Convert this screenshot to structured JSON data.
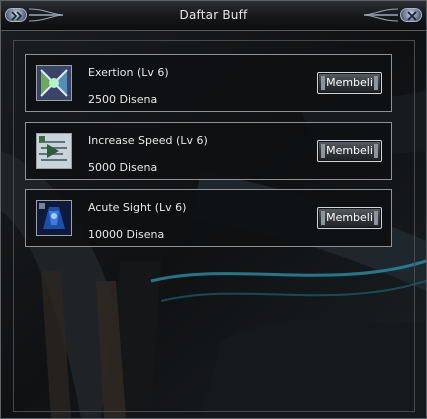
{
  "window": {
    "title": "Daftar Buff"
  },
  "buffs": [
    {
      "name": "Exertion (Lv 6)",
      "price": "2500 Disena",
      "icon": "exertion-icon",
      "button": "Membeli"
    },
    {
      "name": "Increase Speed (Lv 6)",
      "price": "5000 Disena",
      "icon": "increase-speed-icon",
      "button": "Membeli"
    },
    {
      "name": "Acute Sight (Lv 6)",
      "price": "10000 Disena",
      "icon": "acute-sight-icon",
      "button": "Membeli"
    }
  ],
  "colors": {
    "text": "#e8e8e8",
    "frame": "#8e9296",
    "accent": "#2a8fa8"
  }
}
